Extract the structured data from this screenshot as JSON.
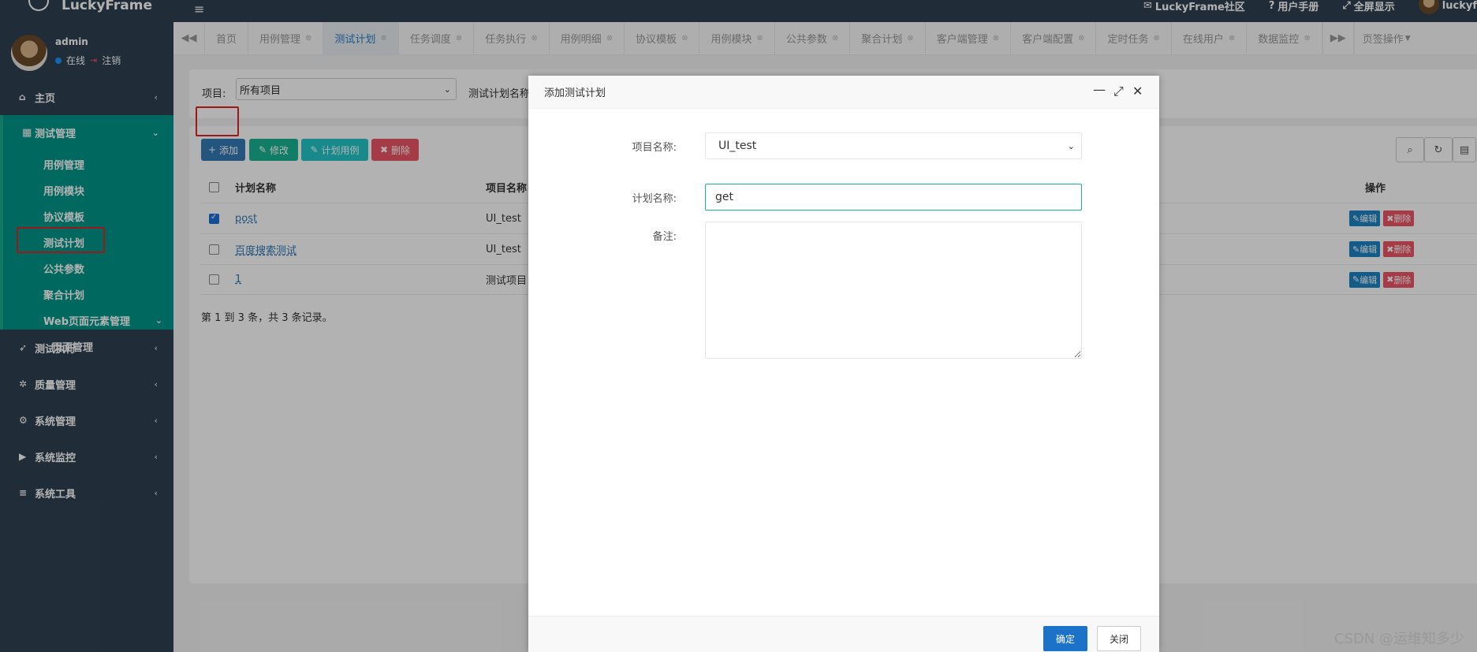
{
  "app": {
    "name": "LuckyFrame"
  },
  "user": {
    "name": "admin",
    "status": "在线",
    "logout": "注销"
  },
  "topbar": {
    "community": "LuckyFrame社区",
    "manual": "用户手册",
    "fullscreen": "全屏显示",
    "account": "luckyf"
  },
  "sidebar": {
    "home": "主页",
    "test_manage": "测试管理",
    "test_manage_items": [
      "用例管理",
      "用例模块",
      "协议模板",
      "测试计划",
      "公共参数",
      "聚合计划"
    ],
    "web_elements": "Web页面元素管理",
    "page_manage": "页面管理",
    "items": [
      "测试执行",
      "质量管理",
      "系统管理",
      "系统监控",
      "系统工具"
    ]
  },
  "tabs": [
    "首页",
    "用例管理",
    "测试计划",
    "任务调度",
    "任务执行",
    "用例明细",
    "协议模板",
    "用例模块",
    "公共参数",
    "聚合计划",
    "客户端管理",
    "客户端配置",
    "定时任务",
    "在线用户",
    "数据监控"
  ],
  "tab_ops": "页签操作",
  "filter": {
    "project_label": "项目:",
    "project_value": "所有项目",
    "plan_name_label": "测试计划名称"
  },
  "toolbar": {
    "add": "添加",
    "edit": "修改",
    "plan_case": "计划用例",
    "delete": "删除"
  },
  "table": {
    "headers": {
      "name": "计划名称",
      "project": "项目名称",
      "ops": "操作"
    },
    "rows": [
      {
        "name": "post",
        "project": "UI_test",
        "checked": true
      },
      {
        "name": "百度搜索测试",
        "project": "UI_test",
        "checked": false
      },
      {
        "name": "1",
        "project": "测试项目",
        "checked": false
      }
    ],
    "edit_label": "编辑",
    "delete_label": "删除"
  },
  "pager": "第 1 到 3 条，共 3 条记录。",
  "modal": {
    "title": "添加测试计划",
    "project_label": "项目名称:",
    "project_value": "UI_test",
    "plan_label": "计划名称:",
    "plan_value": "get",
    "remark_label": "备注:",
    "ok": "确定",
    "close": "关闭"
  },
  "watermark": "CSDN @运维知多少",
  "colors": {
    "sidebar": "#2f4050",
    "active_menu": "#009688",
    "primary": "#337ab7",
    "success": "#1ab394",
    "info": "#23c6c8",
    "danger": "#ed5565",
    "highlight": "#e02424"
  }
}
